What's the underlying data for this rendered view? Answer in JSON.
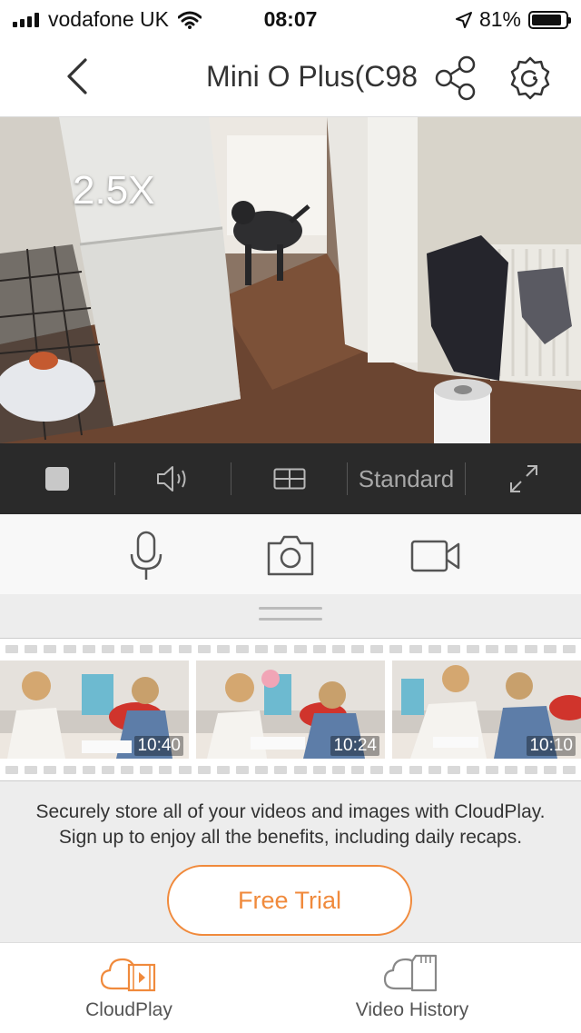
{
  "status": {
    "carrier": "vodafone UK",
    "time": "08:07",
    "battery": "81%",
    "battery_level": 0.81
  },
  "header": {
    "title": "Mini O Plus(C98"
  },
  "video": {
    "zoom_label": "2.5X"
  },
  "controls": {
    "quality": "Standard"
  },
  "clips": [
    {
      "time": "10:40"
    },
    {
      "time": "10:24"
    },
    {
      "time": "10:10"
    }
  ],
  "promo": {
    "line1": "Securely store all of your videos and images with CloudPlay.",
    "line2": "Sign up to enjoy all the benefits, including daily recaps.",
    "cta": "Free Trial"
  },
  "tabs": [
    {
      "label": "CloudPlay",
      "icon": "cloud-film-icon",
      "active": true
    },
    {
      "label": "Video History",
      "icon": "cloud-sdcard-icon",
      "active": false
    }
  ],
  "colors": {
    "accent": "#f08a3c",
    "control_bar": "#2a2a2a"
  }
}
